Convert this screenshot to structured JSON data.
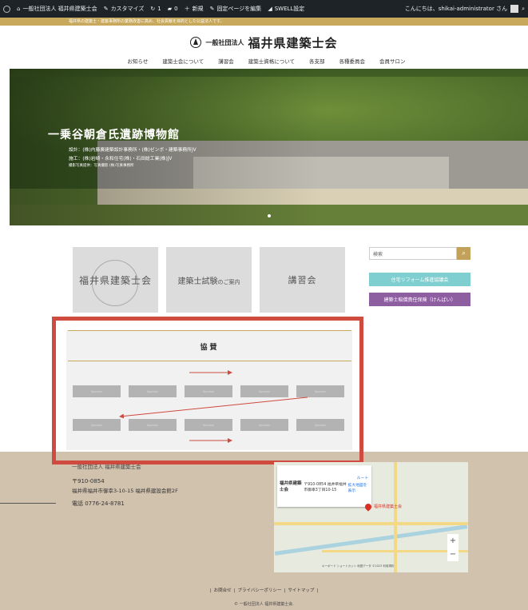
{
  "admin_bar": {
    "site_name": "一般社団法人 福井県建築士会",
    "customize": "カスタマイズ",
    "updates": "1",
    "comments": "0",
    "new": "新規",
    "edit_page": "固定ページを編集",
    "swell": "SWELL設定",
    "greeting": "こんにちは、shikai-administrator さん"
  },
  "tagline": "福井県の建築士・建築事務所の業務改善に高め、社会貢献を目的とした公益法人です。",
  "header": {
    "logo_small": "一般社団法人",
    "logo_big": "福井県建築士会"
  },
  "nav": [
    "お知らせ",
    "建築士会について",
    "講習会",
    "建築士資格について",
    "各支部",
    "各種委員会",
    "会員サロン"
  ],
  "hero": {
    "title": "一乗谷朝倉氏遺跡博物館",
    "line1": "設計：(株)内藤廣建築設計事務所・(株)ゼンボ・建築事務所JV",
    "line2": "施工：(株)岩崎・永和住宅(株)・石田総工業(株)JV",
    "line3": "撮影写真提供：写真撮影 (株)写真事務所"
  },
  "cards": [
    {
      "title": "福井県建築士会"
    },
    {
      "title": "建築士試験",
      "sub": "のご案内"
    },
    {
      "title": "講習会"
    }
  ],
  "sidebar": {
    "search_placeholder": "検索",
    "search_icon": "search-icon",
    "banner1": "住宅リフォーム推進協議会",
    "banner2": "建築士賠償責任保険（けんばい）"
  },
  "sponsor": {
    "title": "協賛",
    "box_label": "Sponsor"
  },
  "footer": {
    "org_name": "一般社団法人 福井県建築士会",
    "zip": "〒910-0854",
    "address": "福井県福井市御幸3-10-15 福井県建設会館2F",
    "tel": "電話 0776-24-8781",
    "map_card_title": "福井県建築士会",
    "map_card_addr": "〒910-0854 福井県福井市御幸3丁目10-15",
    "map_card_route": "ルート",
    "map_card_link": "拡大地図を表示",
    "map_pin_label": "福井県建築士会",
    "map_attribution": "キーボード ショートカット  地図データ ©2023  利用規約",
    "links": [
      "お問合せ",
      "プライバシーポリシー",
      "サイトマップ"
    ],
    "copyright": "© 一般社団法人 福井県建築士会."
  },
  "colors": {
    "accent": "#c2a25a",
    "admin_bar": "#1d2327",
    "footer": "#d1c2ae",
    "annotation_red": "#cf4a3f",
    "banner_teal": "#7fcfd0",
    "banner_purple": "#8e5fa0"
  }
}
